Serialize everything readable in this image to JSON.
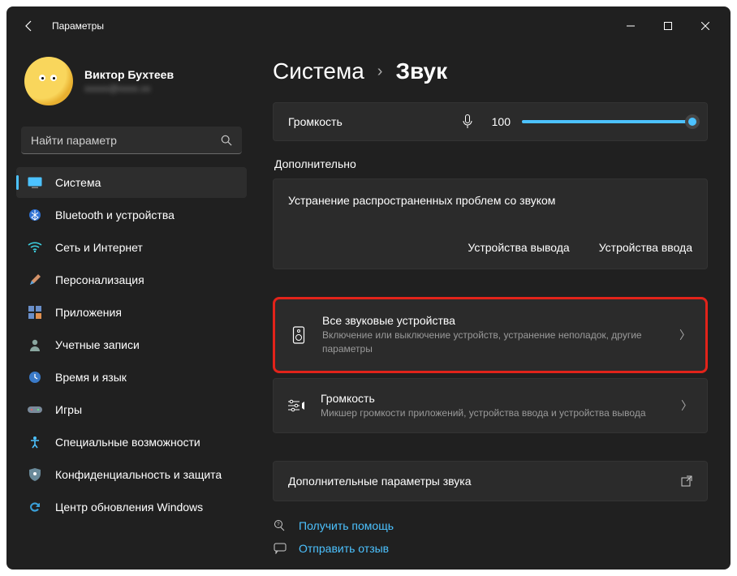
{
  "window": {
    "title": "Параметры"
  },
  "profile": {
    "name": "Виктор Бухтеев",
    "email": "xxxxx@xxxx.xx"
  },
  "search": {
    "placeholder": "Найти параметр"
  },
  "nav": [
    {
      "label": "Система",
      "active": true
    },
    {
      "label": "Bluetooth и устройства"
    },
    {
      "label": "Сеть и Интернет"
    },
    {
      "label": "Персонализация"
    },
    {
      "label": "Приложения"
    },
    {
      "label": "Учетные записи"
    },
    {
      "label": "Время и язык"
    },
    {
      "label": "Игры"
    },
    {
      "label": "Специальные возможности"
    },
    {
      "label": "Конфиденциальность и защита"
    },
    {
      "label": "Центр обновления Windows"
    }
  ],
  "breadcrumb": {
    "parent": "Система",
    "sep": "›",
    "current": "Звук"
  },
  "volume": {
    "label": "Громкость",
    "value": "100",
    "percent": 100
  },
  "sections": {
    "more": "Дополнительно"
  },
  "troubleshoot": {
    "title": "Устранение распространенных проблем со звуком",
    "output": "Устройства вывода",
    "input": "Устройства ввода"
  },
  "items": {
    "all_devices": {
      "title": "Все звуковые устройства",
      "desc": "Включение или выключение устройств, устранение неполадок, другие параметры"
    },
    "mixer": {
      "title": "Громкость",
      "desc": "Микшер громкости приложений, устройства ввода и устройства вывода"
    },
    "more_sound": {
      "title": "Дополнительные параметры звука"
    }
  },
  "footer": {
    "help": "Получить помощь",
    "feedback": "Отправить отзыв"
  }
}
